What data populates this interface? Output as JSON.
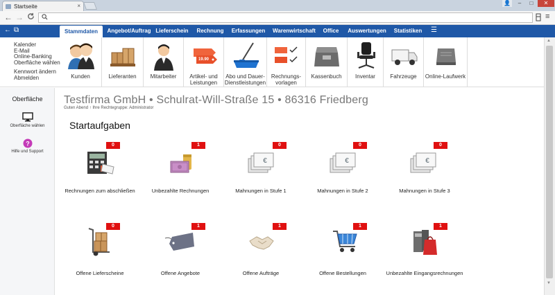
{
  "browser": {
    "tab_title": "Startseite",
    "tab_close": "×",
    "win_user": "👤",
    "win_min": "–",
    "win_max": "□",
    "win_close": "✕",
    "back": "←",
    "forward": "→",
    "reload": "C",
    "address_value": "",
    "search_icon": "search-icon"
  },
  "nav": {
    "tabs": [
      "Stammdaten",
      "Angebot/Auftrag",
      "Lieferschein",
      "Rechnung",
      "Erfassungen",
      "Warenwirtschaft",
      "Office",
      "Auswertungen",
      "Statistiken"
    ],
    "active": "Stammdaten",
    "back_icon": "←",
    "window_icon": "⧉",
    "menu_icon": "☰"
  },
  "shortcuts": [
    "Kalender",
    "E-Mail",
    "Online-Banking",
    "Oberfläche wählen",
    "Kennwort ändern",
    "Abmelden"
  ],
  "ribbon": [
    {
      "label": "Kunden",
      "icon": "customers-icon"
    },
    {
      "label": "Lieferanten",
      "icon": "suppliers-icon"
    },
    {
      "label": "Mitarbeiter",
      "icon": "employee-icon"
    },
    {
      "label": "Artikel- und Leistungen",
      "icon": "price-tags-icon"
    },
    {
      "label": "Abo und Dauer- Dienstleistungen",
      "icon": "mop-bucket-icon"
    },
    {
      "label": "Rechnungs- vorlagen",
      "icon": "invoice-template-icon"
    },
    {
      "label": "Kassenbuch",
      "icon": "cashbox-icon"
    },
    {
      "label": "Inventar",
      "icon": "office-chair-icon"
    },
    {
      "label": "Fahrzeuge",
      "icon": "van-icon"
    },
    {
      "label": "Online-Laufwerk",
      "icon": "drive-icon"
    }
  ],
  "ribbon_extra": {
    "price_tag": "19.90"
  },
  "sidebar": {
    "title": "Oberfläche",
    "items": [
      {
        "label": "Oberfläche wählen",
        "icon": "monitor-icon"
      },
      {
        "label": "Hilfe und Support",
        "icon": "help-icon"
      }
    ]
  },
  "main": {
    "company": "Testfirma GmbH • Schulrat-Will-Straße 15 • 86316 Friedberg",
    "greeting": "Guten Abend ↑ Ihre Rechtegruppe: Administrator",
    "section_title": "Startaufgaben",
    "tasks": [
      {
        "label": "Rechnungen zum abschließen",
        "count": "0",
        "icon": "calculator-icon"
      },
      {
        "label": "Unbezahlte Rechnungen",
        "count": "1",
        "icon": "money-icon"
      },
      {
        "label": "Mahnungen in Stufe 1",
        "count": "0",
        "icon": "euro-reminder-icon"
      },
      {
        "label": "Mahnungen in Stufe 2",
        "count": "0",
        "icon": "euro-reminder-icon"
      },
      {
        "label": "Mahnungen in Stufe 3",
        "count": "0",
        "icon": "euro-reminder-icon"
      },
      {
        "label": "Offene Lieferscheine",
        "count": "0",
        "icon": "hand-truck-icon"
      },
      {
        "label": "Offene Angebote",
        "count": "1",
        "icon": "tag-icon"
      },
      {
        "label": "Offene Aufträge",
        "count": "1",
        "icon": "handshake-icon"
      },
      {
        "label": "Offene Bestellungen",
        "count": "1",
        "icon": "shopping-cart-icon"
      },
      {
        "label": "Unbezahlte Eingangsrechnungen",
        "count": "1",
        "icon": "folder-bag-icon"
      }
    ]
  },
  "euro_symbol": "€"
}
